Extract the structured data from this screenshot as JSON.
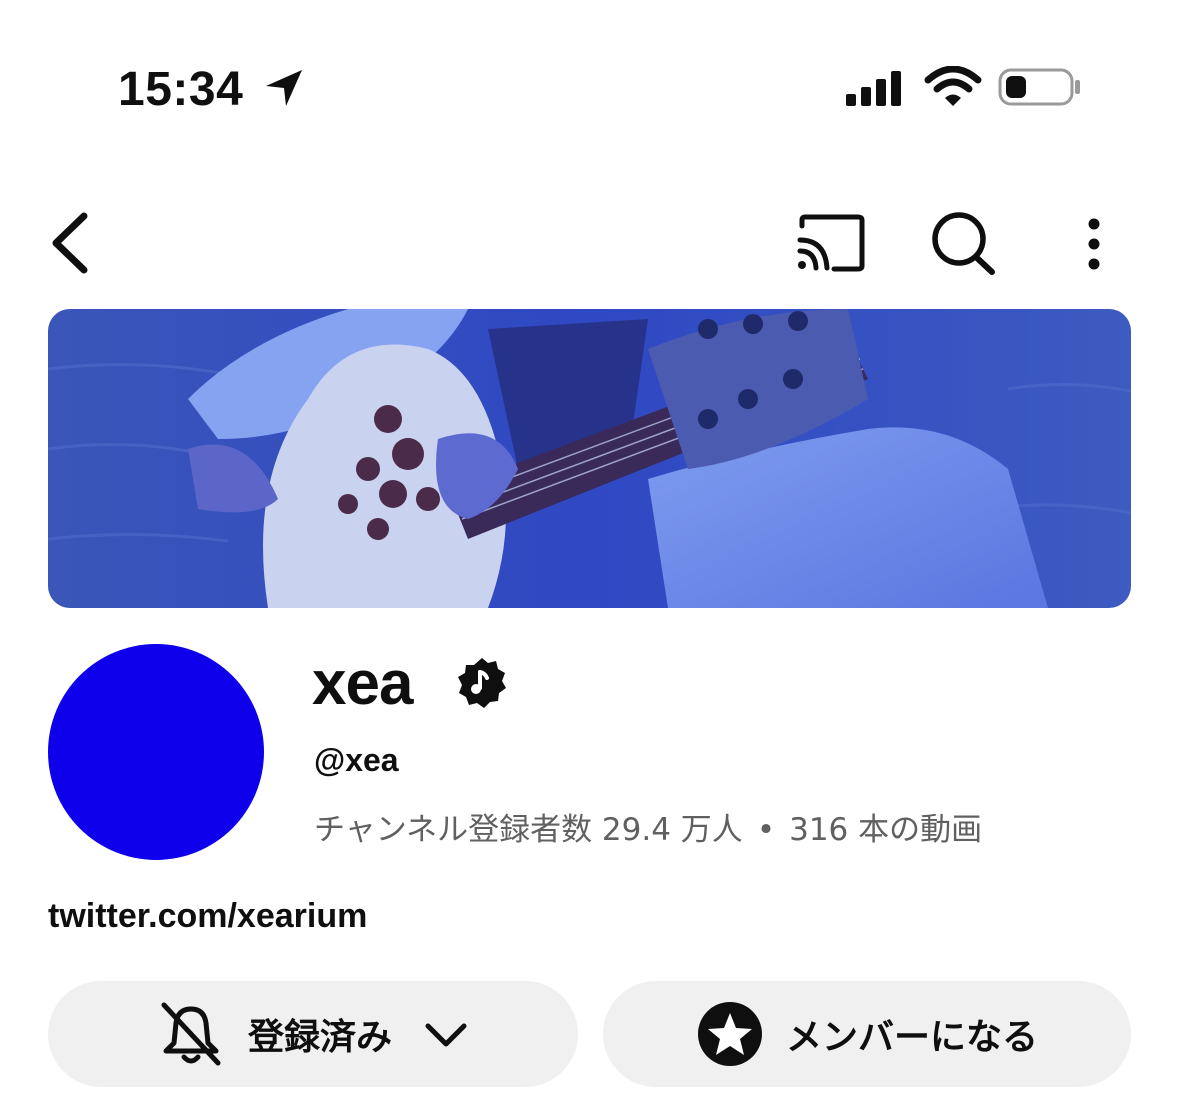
{
  "status_bar": {
    "time": "15:34",
    "icons": [
      "location-arrow-icon",
      "cellular-signal-icon",
      "wifi-icon",
      "battery-icon"
    ]
  },
  "top_bar": {
    "icons": [
      "back-chevron-icon",
      "cast-icon",
      "search-icon",
      "more-vertical-icon"
    ]
  },
  "channel": {
    "name": "xea",
    "verified_icon": "music-note-verified-icon",
    "handle": "@xea",
    "subscribers": "チャンネル登録者数 29.4 万人",
    "separator": "•",
    "videos": "316 本の動画",
    "link": "twitter.com/xearium",
    "avatar_color": "#0f00ec"
  },
  "actions": {
    "subscribed_label": "登録済み",
    "member_label": "メンバーになる"
  },
  "colors": {
    "text": "#0f0f0f",
    "secondary_text": "#606060",
    "button_bg": "#f0f0f0",
    "banner_tint": "#2a3fc8"
  }
}
